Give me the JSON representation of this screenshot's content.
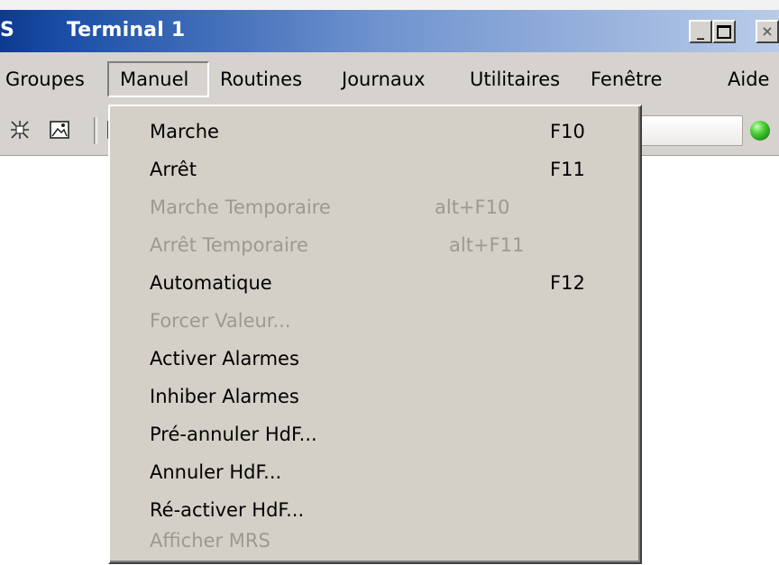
{
  "window": {
    "app_abbrev": "S",
    "title": "Terminal 1",
    "controls": {
      "minimize": "_",
      "close": "×"
    }
  },
  "menubar": {
    "items": [
      {
        "label": "Groupes",
        "active": false
      },
      {
        "label": "Manuel",
        "active": true
      },
      {
        "label": "Routines",
        "active": false
      },
      {
        "label": "Journaux",
        "active": false
      },
      {
        "label": "Utilitaires",
        "active": false
      },
      {
        "label": "Fenêtre",
        "active": false
      },
      {
        "label": "Aide",
        "active": false
      }
    ]
  },
  "toolbar": {
    "icons": [
      "snowflake-grid-icon",
      "image-icon",
      "page-icon"
    ],
    "status_led_color": "#2fb51f"
  },
  "dropdown": {
    "items": [
      {
        "label": "Marche",
        "shortcut": "F10",
        "enabled": true
      },
      {
        "label": "Arrêt",
        "shortcut": "F11",
        "enabled": true
      },
      {
        "label": "Marche Temporaire",
        "shortcut": "alt+F10",
        "enabled": false
      },
      {
        "label": "Arrêt Temporaire",
        "shortcut": "alt+F11",
        "enabled": false
      },
      {
        "label": "Automatique",
        "shortcut": "F12",
        "enabled": true
      },
      {
        "label": "Forcer Valeur...",
        "shortcut": "",
        "enabled": false
      },
      {
        "label": "Activer Alarmes",
        "shortcut": "",
        "enabled": true
      },
      {
        "label": "Inhiber Alarmes",
        "shortcut": "",
        "enabled": true
      },
      {
        "label": "Pré-annuler HdF...",
        "shortcut": "",
        "enabled": true
      },
      {
        "label": "Annuler HdF...",
        "shortcut": "",
        "enabled": true
      },
      {
        "label": "Ré-activer HdF...",
        "shortcut": "",
        "enabled": true
      },
      {
        "label": "Afficher MRS",
        "shortcut": "",
        "enabled": false
      }
    ]
  },
  "colors": {
    "title_gradient_start": "#0d3a8f",
    "title_gradient_end": "#b9cbe8",
    "face": "#d4d0c8",
    "disabled_text": "#9a9994"
  }
}
